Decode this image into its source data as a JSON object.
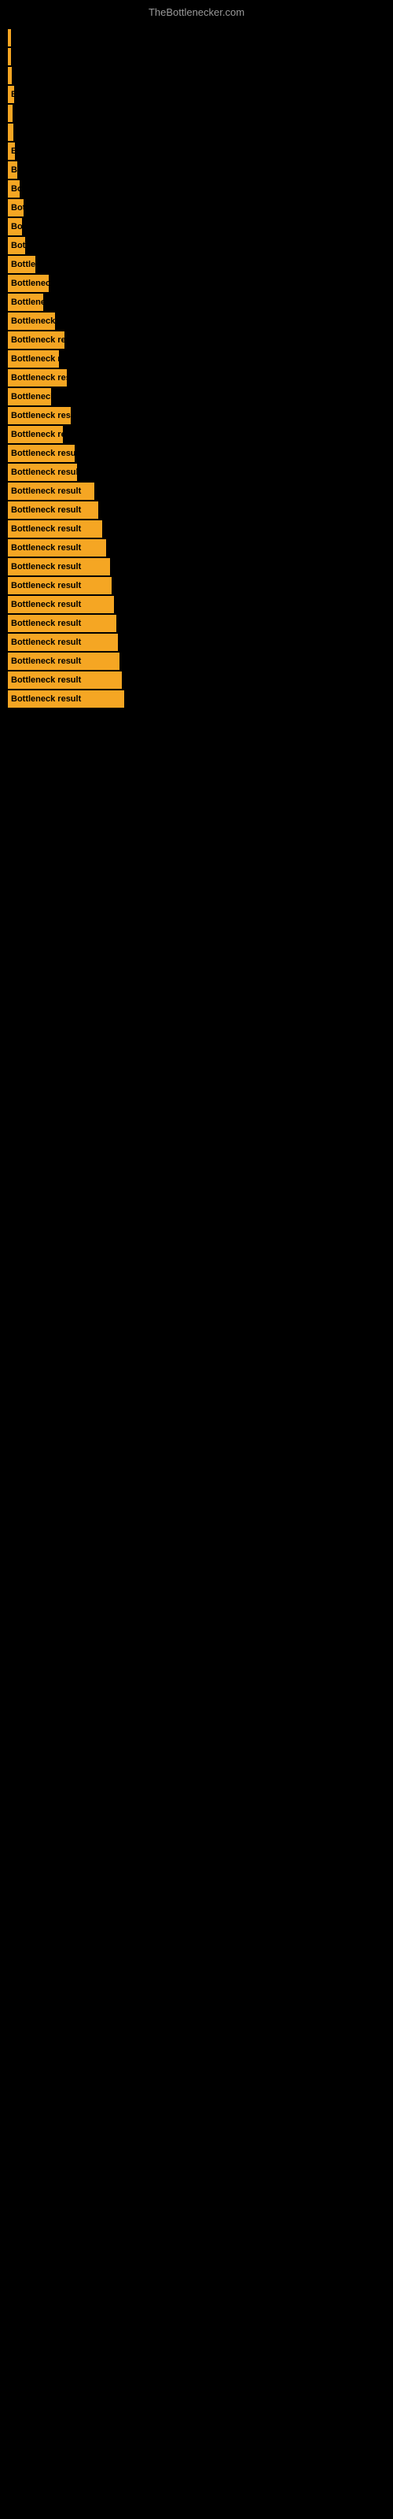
{
  "header": {
    "title": "TheBottlenecker.com"
  },
  "bars": [
    {
      "width": 2,
      "label": ""
    },
    {
      "width": 4,
      "label": ""
    },
    {
      "width": 5,
      "label": ""
    },
    {
      "width": 8,
      "label": "E"
    },
    {
      "width": 6,
      "label": ""
    },
    {
      "width": 7,
      "label": ""
    },
    {
      "width": 9,
      "label": "E"
    },
    {
      "width": 12,
      "label": "B"
    },
    {
      "width": 15,
      "label": "Bo"
    },
    {
      "width": 20,
      "label": "Bot"
    },
    {
      "width": 18,
      "label": "Bo"
    },
    {
      "width": 22,
      "label": "Bott"
    },
    {
      "width": 35,
      "label": "Bottlenec"
    },
    {
      "width": 52,
      "label": "Bottleneck re"
    },
    {
      "width": 45,
      "label": "Bottleneck"
    },
    {
      "width": 60,
      "label": "Bottleneck res"
    },
    {
      "width": 72,
      "label": "Bottleneck result"
    },
    {
      "width": 65,
      "label": "Bottleneck res"
    },
    {
      "width": 75,
      "label": "Bottleneck resul"
    },
    {
      "width": 55,
      "label": "Bottleneck re"
    },
    {
      "width": 80,
      "label": "Bottleneck result"
    },
    {
      "width": 70,
      "label": "Bottleneck resu"
    },
    {
      "width": 85,
      "label": "Bottleneck result"
    },
    {
      "width": 88,
      "label": "Bottleneck result"
    },
    {
      "width": 110,
      "label": "Bottleneck result"
    },
    {
      "width": 115,
      "label": "Bottleneck result"
    },
    {
      "width": 120,
      "label": "Bottleneck result"
    },
    {
      "width": 125,
      "label": "Bottleneck result"
    },
    {
      "width": 130,
      "label": "Bottleneck result"
    },
    {
      "width": 132,
      "label": "Bottleneck result"
    },
    {
      "width": 135,
      "label": "Bottleneck result"
    },
    {
      "width": 138,
      "label": "Bottleneck result"
    },
    {
      "width": 140,
      "label": "Bottleneck result"
    },
    {
      "width": 142,
      "label": "Bottleneck result"
    },
    {
      "width": 145,
      "label": "Bottleneck result"
    },
    {
      "width": 148,
      "label": "Bottleneck result"
    }
  ]
}
